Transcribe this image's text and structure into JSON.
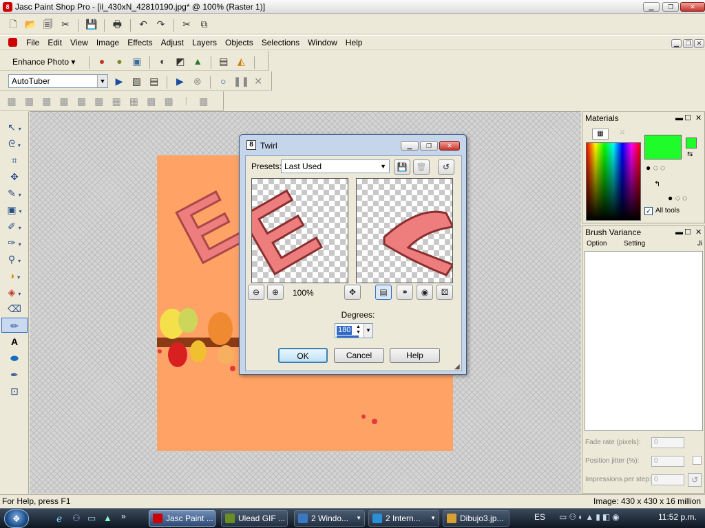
{
  "window": {
    "title": "Jasc Paint Shop Pro - [il_430xN_42810190.jpg* @ 100% (Raster 1)]",
    "icon_label": "8"
  },
  "menu": [
    "File",
    "Edit",
    "View",
    "Image",
    "Effects",
    "Adjust",
    "Layers",
    "Objects",
    "Selections",
    "Window",
    "Help"
  ],
  "toolbars": {
    "enhance_photo_label": "Enhance Photo",
    "script_name": "AutoTuber"
  },
  "canvas": {
    "letter_big": "E",
    "letter_small": "E"
  },
  "materials": {
    "title": "Materials",
    "all_tools_label": "All tools",
    "foreground_color": "#1efc2a"
  },
  "brush_variance": {
    "title": "Brush Variance",
    "col_option": "Option",
    "col_setting": "Setting",
    "col_jitter": "Ji",
    "fade_rate_label": "Fade rate (pixels):",
    "fade_rate_value": "0",
    "position_jitter_label": "Position jitter (%):",
    "position_jitter_value": "0",
    "impressions_label": "Impressions per step:",
    "impressions_value": "0"
  },
  "dialog": {
    "title": "Twirl",
    "icon_label": "8",
    "presets_label": "Presets:",
    "presets_value": "Last Used",
    "zoom": "100%",
    "degrees_label": "Degrees:",
    "degrees_value": "180",
    "ok": "OK",
    "cancel": "Cancel",
    "help": "Help",
    "preview_letter": "E"
  },
  "status": {
    "help_text": "For Help, press F1",
    "image_info": "Image:  430 x 430 x 16 million"
  },
  "taskbar": {
    "tasks": [
      "Jasc Paint ...",
      "Ulead GIF ...",
      "2 Windo...",
      "2 Intern...",
      "Dibujo3.jp..."
    ],
    "language": "ES",
    "clock": "11:52 p.m."
  }
}
